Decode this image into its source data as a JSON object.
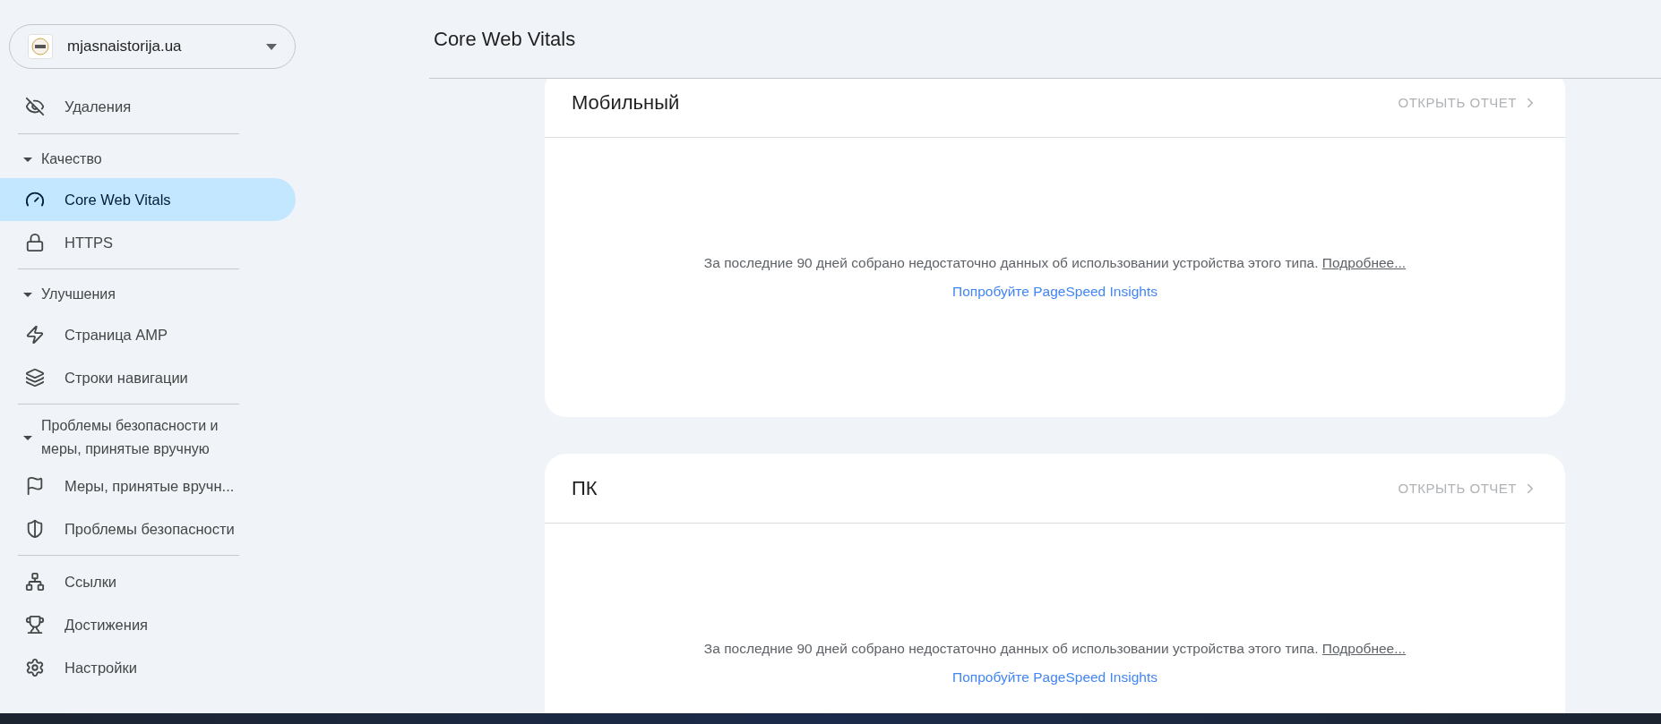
{
  "property_selector": {
    "name": "mjasnaistorija.ua"
  },
  "sidebar": {
    "sections": [
      {
        "items": [
          {
            "label": "Удаления",
            "kind": "removals",
            "selected": false
          }
        ]
      },
      {
        "heading": "Качество",
        "expanded": true,
        "items": [
          {
            "label": "Core Web Vitals",
            "kind": "vitals",
            "selected": true
          },
          {
            "label": "HTTPS",
            "kind": "https",
            "selected": false
          }
        ]
      },
      {
        "heading": "Улучшения",
        "expanded": true,
        "items": [
          {
            "label": "Страница AMP",
            "kind": "amp",
            "selected": false
          },
          {
            "label": "Строки навигации",
            "kind": "breadcrumbs",
            "selected": false
          }
        ]
      },
      {
        "heading": "Проблемы безопасности и меры, принятые вручную",
        "expanded": true,
        "items": [
          {
            "label": "Меры, принятые вручн...",
            "kind": "actions",
            "selected": false
          },
          {
            "label": "Проблемы безопасности",
            "kind": "security",
            "selected": false
          }
        ]
      },
      {
        "items": [
          {
            "label": "Ссылки",
            "kind": "links",
            "selected": false
          },
          {
            "label": "Достижения",
            "kind": "achievements",
            "selected": false
          },
          {
            "label": "Настройки",
            "kind": "settings",
            "selected": false
          }
        ]
      }
    ]
  },
  "page_title": "Core Web Vitals",
  "cards": [
    {
      "title": "Мобильный",
      "action": "ОТКРЫТЬ ОТЧЕТ",
      "message": "За последние 90 дней собрано недостаточно данных об использовании устройства этого типа.",
      "more_link": "Подробнее...",
      "tool_link": "Попробуйте PageSpeed Insights"
    },
    {
      "title": "ПК",
      "action": "ОТКРЫТЬ ОТЧЕТ",
      "message": "За последние 90 дней собрано недостаточно данных об использовании устройства этого типа.",
      "more_link": "Подробнее...",
      "tool_link": "Попробуйте PageSpeed Insights"
    }
  ]
}
